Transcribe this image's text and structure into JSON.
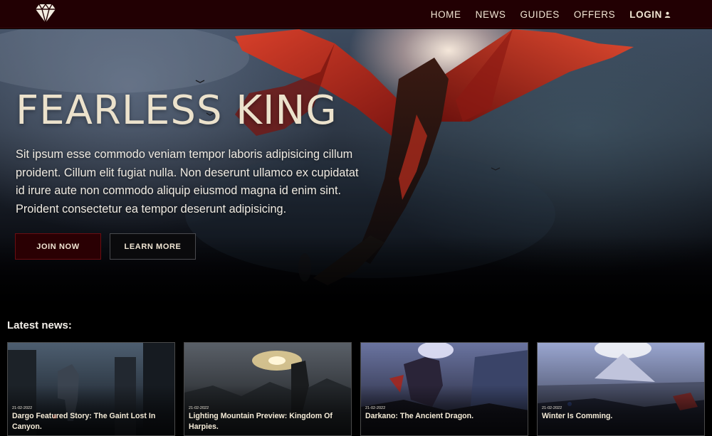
{
  "nav": {
    "logo_icon": "diamond-logo-icon",
    "items": [
      {
        "label": "HOME"
      },
      {
        "label": "NEWS"
      },
      {
        "label": "GUIDES"
      },
      {
        "label": "OFFERS"
      }
    ],
    "login": {
      "label": "LOGIN",
      "icon": "user-icon"
    }
  },
  "hero": {
    "title": "FEARLESS KING",
    "description": "Sit ipsum esse commodo veniam tempor laboris adipisicing cillum proident. Cillum elit fugiat nulla. Non deserunt ullamco ex cupidatat id irure aute non commodo aliquip eiusmod magna id enim sint. Proident consectetur ea tempor deserunt adipisicing.",
    "join_label": "JOIN NOW",
    "learn_label": "LEARN MORE"
  },
  "news": {
    "heading": "Latest news:",
    "items": [
      {
        "date": "21-02-2022",
        "title": "Dargo Featured Story: The Gaint Lost In Canyon."
      },
      {
        "date": "21-02-2022",
        "title": "Lighting Mountain Preview: Kingdom Of Harpies."
      },
      {
        "date": "21-02-2022",
        "title": "Darkano: The Ancient Dragon."
      },
      {
        "date": "21-02-2022",
        "title": "Winter Is Comming."
      }
    ]
  },
  "colors": {
    "nav_bg": "#220003",
    "accent": "#6a0d12",
    "title_text": "#ece2cc"
  }
}
